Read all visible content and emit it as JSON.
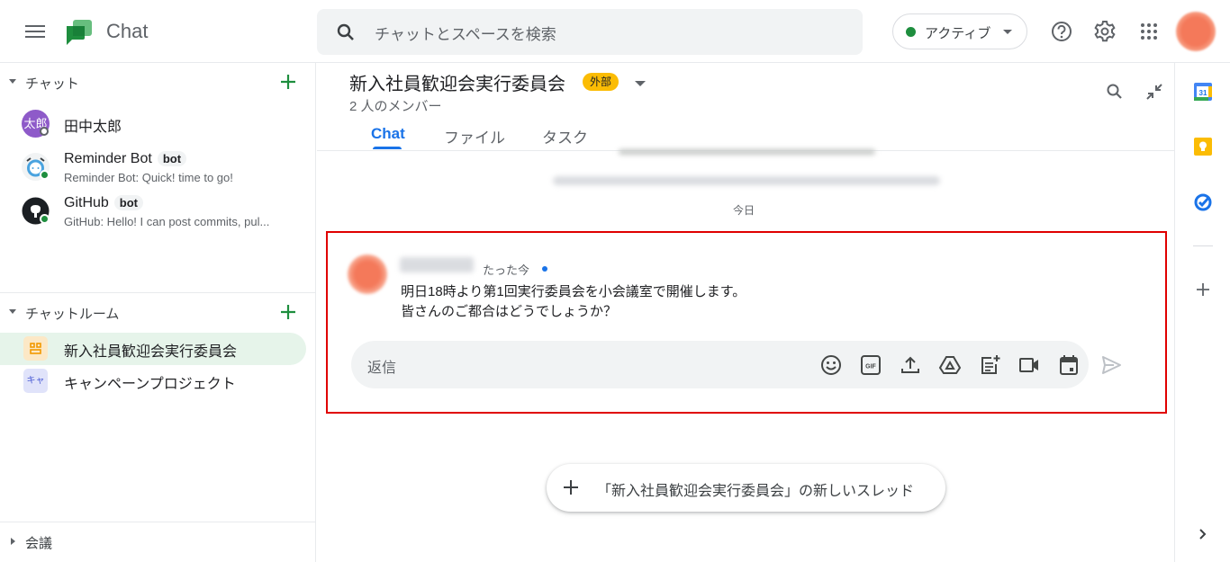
{
  "app": {
    "title": "Chat"
  },
  "search": {
    "placeholder": "チャットとスペースを検索"
  },
  "status": {
    "label": "アクティブ",
    "color": "#1e8e3e"
  },
  "sidebar": {
    "chat_section": {
      "title": "チャット"
    },
    "chats": [
      {
        "name": "田中太郎",
        "avatar_text": "太郎",
        "presence": "offline"
      },
      {
        "name": "Reminder Bot",
        "tag": "bot",
        "preview": "Reminder Bot: Quick! time to go!",
        "presence": "online"
      },
      {
        "name": "GitHub",
        "tag": "bot",
        "preview": "GitHub: Hello! I can post commits, pul...",
        "presence": "online"
      }
    ],
    "room_section": {
      "title": "チャットルーム"
    },
    "rooms": [
      {
        "name": "新入社員歓迎会実行委員会",
        "icon_text": "",
        "active": true
      },
      {
        "name": "キャンペーンプロジェクト",
        "icon_text": "キャ",
        "active": false
      }
    ],
    "meet_section": {
      "title": "会議"
    }
  },
  "room": {
    "title": "新入社員歓迎会実行委員会",
    "badge": "外部",
    "members": "2 人のメンバー",
    "tabs": [
      {
        "label": "Chat",
        "active": true
      },
      {
        "label": "ファイル",
        "active": false
      },
      {
        "label": "タスク",
        "active": false
      }
    ]
  },
  "conversation": {
    "date_divider": "今日",
    "message": {
      "time": "たった今",
      "lines": [
        "明日18時より第1回実行委員会を小会議室で開催します。",
        "皆さんのご都合はどうでしょうか？"
      ]
    },
    "reply_placeholder": "返信",
    "new_thread_label": "「新入社員歓迎会実行委員会」の新しいスレッド"
  },
  "colors": {
    "accent": "#1a73e8",
    "highlight_border": "#e00000",
    "badge": "#fbbc04",
    "active_room": "#e6f4ea"
  }
}
